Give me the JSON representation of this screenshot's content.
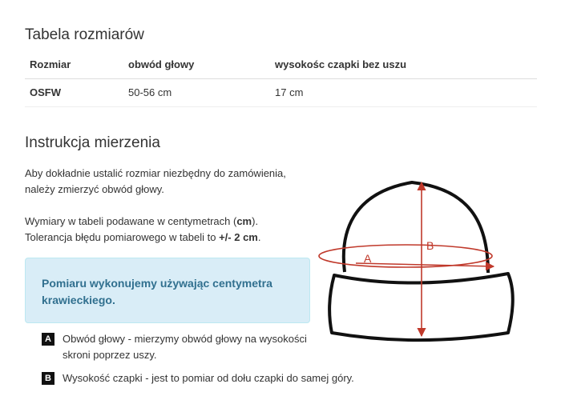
{
  "size_table": {
    "title": "Tabela rozmiarów",
    "headers": [
      "Rozmiar",
      "obwód głowy",
      "wysokośc czapki bez uszu"
    ],
    "rows": [
      [
        "OSFW",
        "50-56 cm",
        "17 cm"
      ]
    ]
  },
  "instructions": {
    "title": "Instrukcja mierzenia",
    "para1_line1": "Aby dokładnie ustalić rozmiar niezbędny do zamówienia,",
    "para1_line2": "należy zmierzyć obwód głowy.",
    "para2_line1_pre": "Wymiary w tabeli podawane w centymetrach (",
    "para2_line1_bold": "cm",
    "para2_line1_post": ").",
    "para2_line2_pre": "Tolerancja błędu pomiarowego w tabeli to ",
    "para2_line2_bold": "+/- 2 cm",
    "para2_line2_post": ".",
    "info_box": "Pomiaru wykonujemy używając centymetra krawieckiego.",
    "legend": [
      {
        "badge": "A",
        "text": "Obwód głowy - mierzymy obwód głowy na wysokości skroni poprzez uszy."
      },
      {
        "badge": "B",
        "text": "Wysokość czapki - jest to pomiar od dołu czapki do samej góry."
      }
    ]
  },
  "diagram": {
    "label_a": "A",
    "label_b": "B",
    "measure_color": "#c0392b",
    "outline_color": "#111111"
  }
}
